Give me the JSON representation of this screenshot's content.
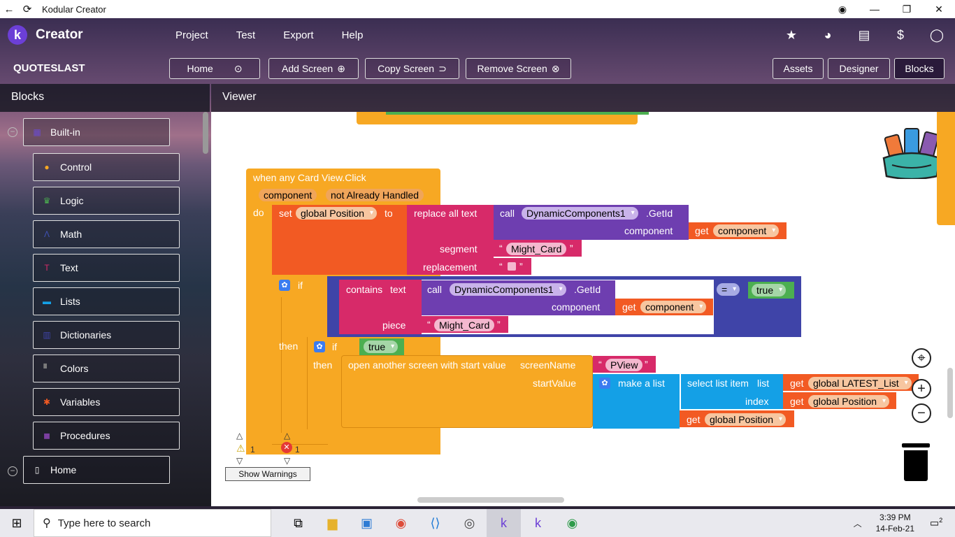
{
  "window": {
    "title": "Kodular Creator"
  },
  "app": {
    "brand": "Creator",
    "logo_letter": "k",
    "menu": [
      "Project",
      "Test",
      "Export",
      "Help"
    ],
    "icons": [
      "star-folder-icon",
      "palette-icon",
      "catalog-icon",
      "dollar-icon",
      "account-icon"
    ]
  },
  "project": {
    "name": "QUOTESLAST",
    "screen_select": "Home",
    "add_screen": "Add Screen",
    "copy_screen": "Copy Screen",
    "remove_screen": "Remove Screen",
    "assets": "Assets",
    "designer": "Designer",
    "blocks": "Blocks"
  },
  "blocks_panel": {
    "title": "Blocks",
    "builtin": "Built-in",
    "categories": [
      {
        "label": "Control",
        "color": "#f7a823"
      },
      {
        "label": "Logic",
        "color": "#4caf50"
      },
      {
        "label": "Math",
        "color": "#3f51b5"
      },
      {
        "label": "Text",
        "color": "#d72a69"
      },
      {
        "label": "Lists",
        "color": "#14a0e6"
      },
      {
        "label": "Dictionaries",
        "color": "#3f44a8"
      },
      {
        "label": "Colors",
        "color": "#7a7a7a"
      },
      {
        "label": "Variables",
        "color": "#f25a23"
      },
      {
        "label": "Procedures",
        "color": "#7b3fa0"
      }
    ],
    "screen": "Home"
  },
  "viewer": {
    "title": "Viewer",
    "event": {
      "header": "when any Card View.Click",
      "param1": "component",
      "param2": "not Already Handled",
      "do": "do",
      "set": "set",
      "var": "global Position",
      "to": "to",
      "replace_all": "replace all text",
      "call": "call",
      "dyn": "DynamicComponents1",
      "getid": ".GetId",
      "component": "component",
      "get": "get",
      "segment": "segment",
      "might_card": "Might_Card",
      "replacement": "replacement",
      "if": "if",
      "contains": "contains",
      "text": "text",
      "piece": "piece",
      "eq": "=",
      "true": "true",
      "then": "then",
      "open_screen": "open another screen with start value",
      "screen_name": "screenName",
      "pview": "PView",
      "start_value": "startValue",
      "make_list": "make a list",
      "select_item": "select list item",
      "list": "list",
      "latest_list": "global LATEST_List",
      "index": "index"
    },
    "warnings": {
      "warn_count": "1",
      "error_count": "1",
      "button": "Show Warnings"
    }
  },
  "taskbar": {
    "search_placeholder": "Type here to search",
    "time": "3:39 PM",
    "date": "14-Feb-21",
    "notifications": "2"
  }
}
